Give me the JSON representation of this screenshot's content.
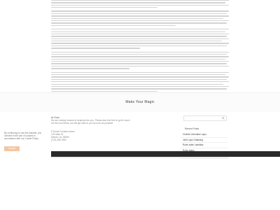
{
  "banner": {
    "title": "Make Your Magic"
  },
  "footer": {
    "about_title": "At Clove",
    "about_text": [
      "We are looking forward to hearing from you. Please also feel free to get in touch",
      "via the form below, we will get back to you as soon as possible."
    ],
    "address": [
      "E-Email Contacts Adam",
      "123 Main St.",
      "Mambo, AL 55080",
      "(123) 456-7890"
    ],
    "search": {
      "placeholder": ""
    },
    "recent_title": "Recent Posts",
    "recent_posts": [
      "Clothed Liberation Laps",
      "Jelbi Laps Ordaining",
      "Rolex table Labellisa",
      "Rolex takes",
      "Rolex attaching"
    ]
  },
  "cookie": {
    "text": [
      "By continuing to use this website, you",
      "consent to the use of cookies in",
      "accordance with our Cookie Policy."
    ],
    "accept_label": "Accept"
  }
}
